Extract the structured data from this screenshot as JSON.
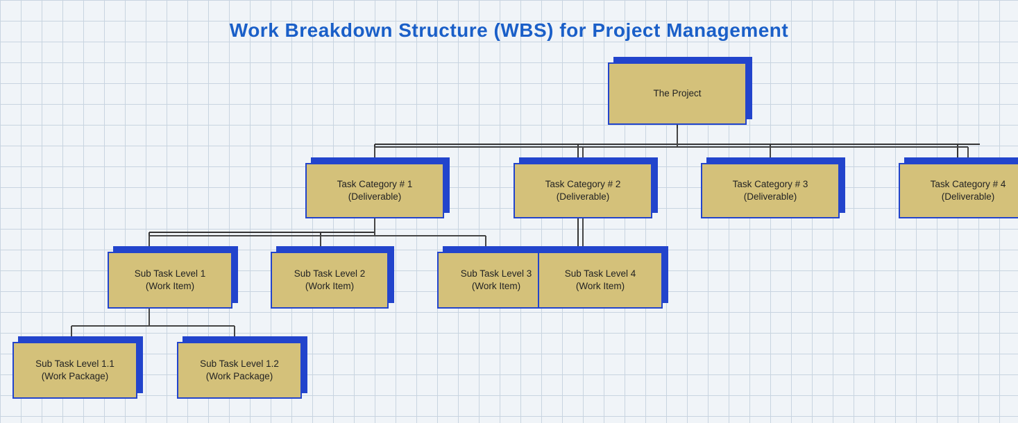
{
  "page": {
    "title": "Work Breakdown Structure (WBS) for Project Management",
    "background_color": "#f0f4f8",
    "grid_color": "#c8d4e0",
    "node_bg": "#d4c17a",
    "node_border": "#2244cc"
  },
  "nodes": {
    "root": {
      "label": "The Project",
      "sub_label": null
    },
    "cat1": {
      "label": "Task Category # 1",
      "sub_label": "(Deliverable)"
    },
    "cat2": {
      "label": "Task Category # 2",
      "sub_label": "(Deliverable)"
    },
    "cat3": {
      "label": "Task Category # 3",
      "sub_label": "(Deliverable)"
    },
    "cat4": {
      "label": "Task Category # 4",
      "sub_label": "(Deliverable)"
    },
    "sub1": {
      "label": "Sub Task Level 1",
      "sub_label": "(Work Item)"
    },
    "sub2": {
      "label": "Sub Task Level 2",
      "sub_label": "(Work Item)"
    },
    "sub3": {
      "label": "Sub Task Level 3",
      "sub_label": "(Work Item)"
    },
    "sub4": {
      "label": "Sub Task Level 4",
      "sub_label": "(Work Item)"
    },
    "pkg1": {
      "label": "Sub Task Level 1.1",
      "sub_label": "(Work Package)"
    },
    "pkg2": {
      "label": "Sub Task Level 1.2",
      "sub_label": "(Work Package)"
    }
  }
}
